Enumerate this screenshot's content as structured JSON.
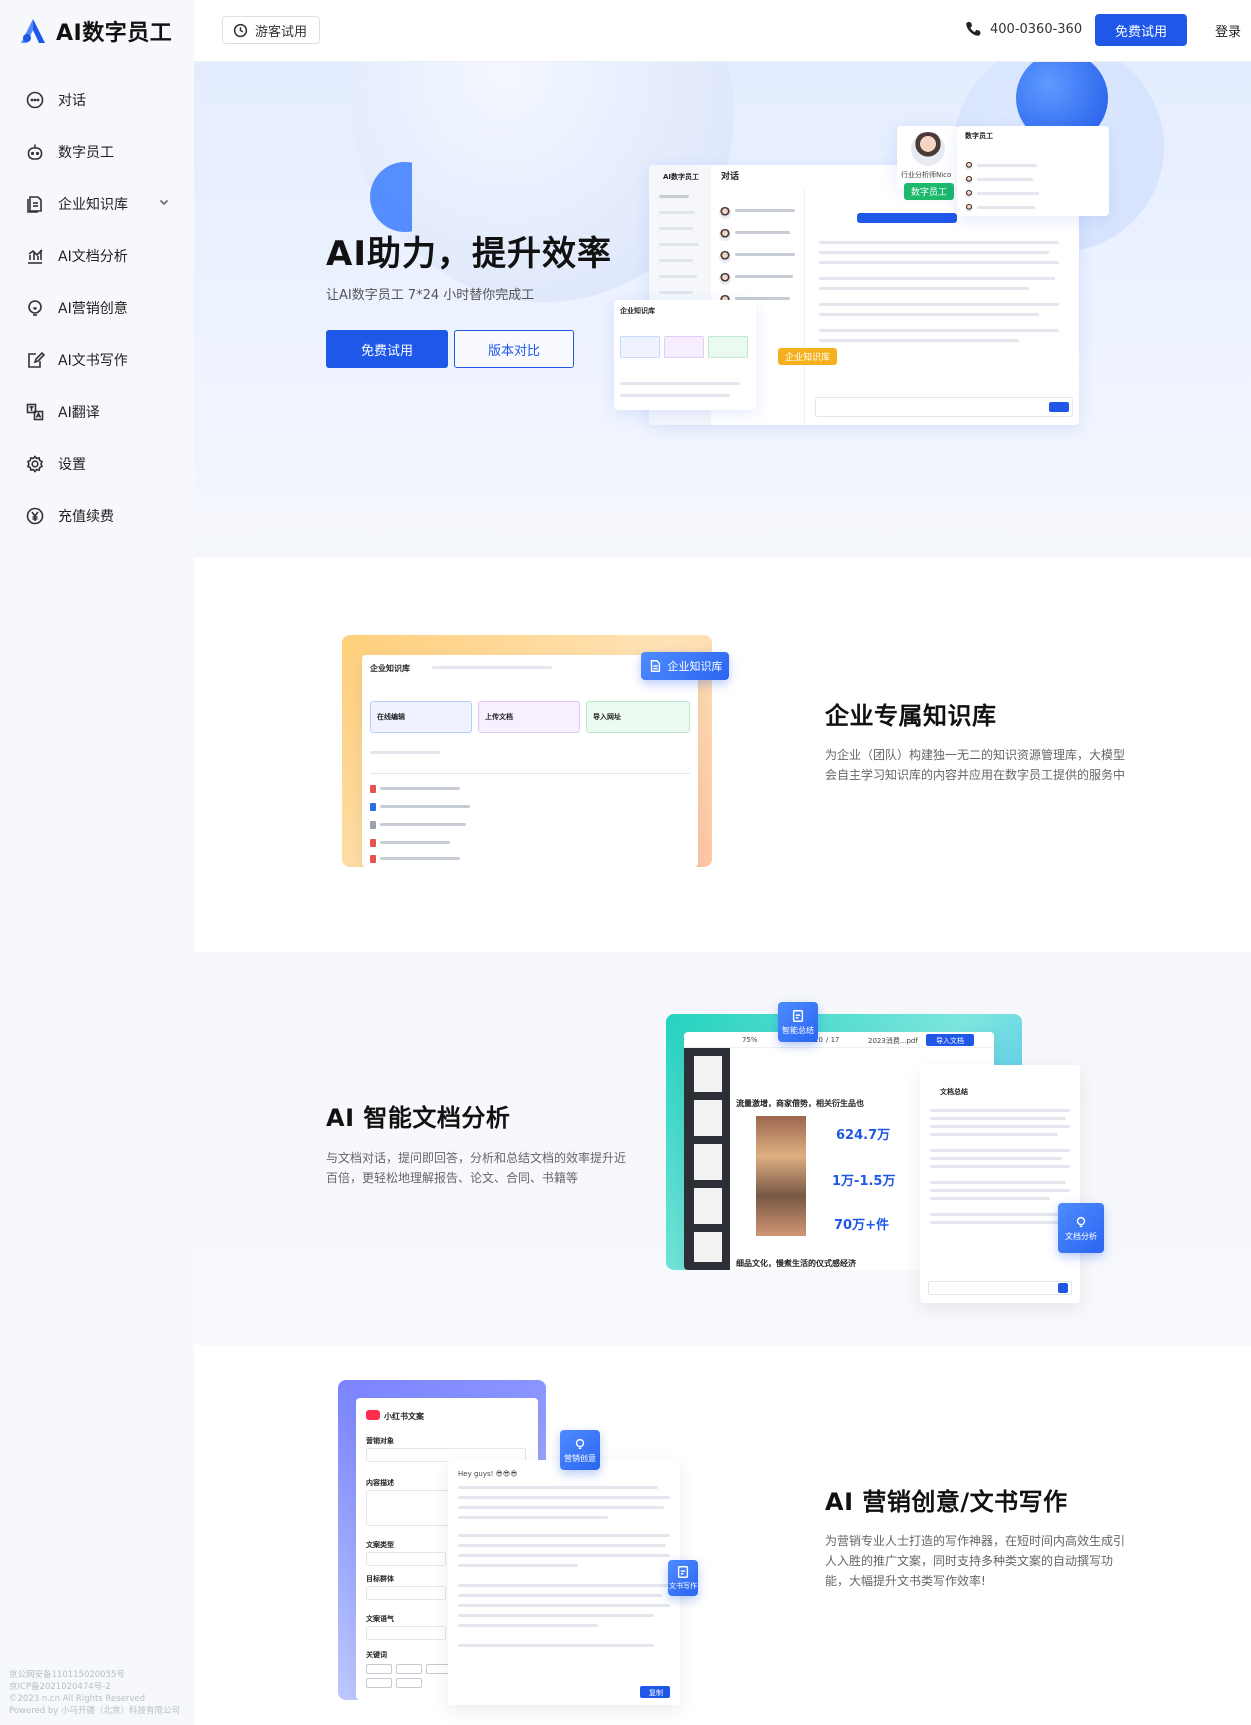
{
  "brand": {
    "name": "AI数字员工",
    "accent": "#1f57e8"
  },
  "sidebar": {
    "items": [
      {
        "label": "对话",
        "icon": "chat-icon"
      },
      {
        "label": "数字员工",
        "icon": "robot-icon"
      },
      {
        "label": "企业知识库",
        "icon": "knowledge-base-icon",
        "expandable": true
      },
      {
        "label": "AI文档分析",
        "icon": "chart-icon"
      },
      {
        "label": "AI营销创意",
        "icon": "lightbulb-icon"
      },
      {
        "label": "AI文书写作",
        "icon": "edit-document-icon"
      },
      {
        "label": "AI翻译",
        "icon": "translate-icon"
      },
      {
        "label": "设置",
        "icon": "gear-icon"
      },
      {
        "label": "充值续费",
        "icon": "yuan-icon"
      }
    ],
    "footer": [
      "京公网安备110115020055号",
      "京ICP备2021020474号-2",
      "©2023 n.cn All Rights Reserved",
      "Powered by 小马开疆（北京）科技有限公司"
    ]
  },
  "header": {
    "guest_label": "游客试用",
    "phone": "400-0360-360",
    "trial_label": "免费试用",
    "login_label": "登录"
  },
  "hero": {
    "title": "AI助力，提升效率",
    "subtitle": "让AI数字员工 7*24 小时替你完成工",
    "primary_button": "免费试用",
    "secondary_button": "版本对比",
    "mock": {
      "app_title": "AI数字员工",
      "chat_title": "对话",
      "avatar_caption": "行业分析师Nico",
      "digital_tag": "数字员工",
      "kb_tag": "企业知识库",
      "kb_window_title": "企业知识库",
      "employee_window_title": "数字员工"
    }
  },
  "sections": [
    {
      "title": "企业专属知识库",
      "desc": "为企业（团队）构建独一无二的知识资源管理库，大模型会自主学习知识库的内容并应用在数字员工提供的服务中",
      "mock_title": "企业知识库",
      "chip_label": "企业知识库",
      "cards": [
        "在线编辑",
        "上传文档",
        "导入网址"
      ]
    },
    {
      "title": "AI 智能文档分析",
      "desc": "与文档对话，提问即回答，分析和总结文档的效率提升近百倍，更轻松地理解报告、论文、合同、书籍等",
      "chip_top": "智能总结",
      "chip_side": "文档分析",
      "zoom": "75%",
      "page": "10",
      "pages": "/ 17",
      "file": "2023消费...pdf",
      "import_btn": "导入文档",
      "heading1": "流量激增，商家借势，相关衍生品也",
      "heading2": "细品文化，慢煮生活的仪式感经济",
      "stats": [
        "624.7万",
        "1万-1.5万",
        "70万+件"
      ],
      "summary_title": "文档总结"
    },
    {
      "title": "AI 营销创意/文书写作",
      "desc": "为营销专业人士打造的写作神器，在短时间内高效生成引人入胜的推广文案，同时支持多种类文案的自动撰写功能，大幅提升文书类写作效率!",
      "mock_title": "小红书文案",
      "chip_top": "营销创意",
      "chip_side": "文书写作",
      "form_labels": [
        "营销对象",
        "内容描述",
        "文案类型",
        "目标群体",
        "文案语气",
        "关键词"
      ],
      "copy_btn": "复制",
      "greeting": "Hey guys! 😎😎😎"
    }
  ]
}
